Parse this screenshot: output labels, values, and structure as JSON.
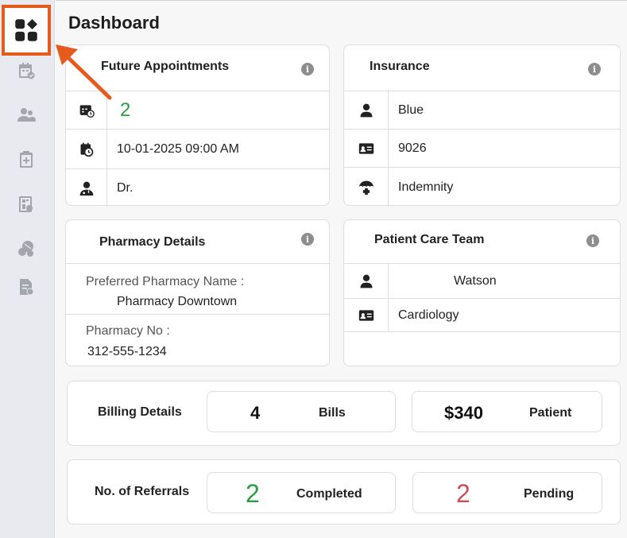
{
  "page": {
    "title": "Dashboard"
  },
  "sidebar": {
    "items": [
      {
        "icon": "dashboard-icon"
      },
      {
        "icon": "calendar-check-icon"
      },
      {
        "icon": "users-icon"
      },
      {
        "icon": "clipboard-plus-icon"
      },
      {
        "icon": "medical-report-icon"
      },
      {
        "icon": "pills-icon"
      },
      {
        "icon": "prescription-document-icon"
      }
    ],
    "accent": "#e55a1d"
  },
  "future_appointments": {
    "title": "Future Appointments",
    "count": "2",
    "datetime": "10-01-2025 09:00 AM",
    "doctor": "Dr."
  },
  "insurance": {
    "title": "Insurance",
    "plan": "Blue",
    "member_id": "9026",
    "type": "Indemnity"
  },
  "pharmacy": {
    "title": "Pharmacy Details",
    "name_label": "Preferred Pharmacy Name :",
    "name": "Pharmacy Downtown",
    "number_label": "Pharmacy No :",
    "number": "312-555-1234"
  },
  "care_team": {
    "title": "Patient Care Team",
    "member": "Watson",
    "specialty": "Cardiology"
  },
  "billing": {
    "title": "Billing Details",
    "bills_count": "4",
    "bills_label": "Bills",
    "patient_amount": "$340",
    "patient_label": "Patient"
  },
  "referrals": {
    "title": "No. of Referrals",
    "completed_count": "2",
    "completed_label": "Completed",
    "pending_count": "2",
    "pending_label": "Pending"
  },
  "colors": {
    "green": "#2e9b46",
    "red": "#c9505a",
    "icon_gray": "#9fa2a8"
  }
}
